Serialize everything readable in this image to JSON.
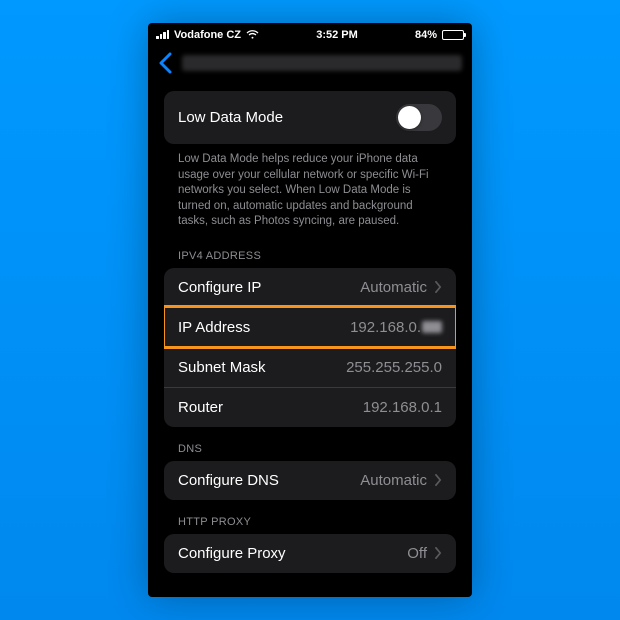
{
  "status": {
    "carrier": "Vodafone CZ",
    "time": "3:52 PM",
    "battery_pct": "84%",
    "battery_fill": 84
  },
  "nav": {
    "back": "Back"
  },
  "low_data": {
    "label": "Low Data Mode",
    "description": "Low Data Mode helps reduce your iPhone data usage over your cellular network or specific Wi-Fi networks you select. When Low Data Mode is turned on, automatic updates and background tasks, such as Photos syncing, are paused."
  },
  "sections": {
    "ipv4_header": "IPV4 ADDRESS",
    "configure_ip_label": "Configure IP",
    "configure_ip_value": "Automatic",
    "ip_address_label": "IP Address",
    "ip_address_value": "192.168.0.",
    "subnet_label": "Subnet Mask",
    "subnet_value": "255.255.255.0",
    "router_label": "Router",
    "router_value": "192.168.0.1",
    "dns_header": "DNS",
    "configure_dns_label": "Configure DNS",
    "configure_dns_value": "Automatic",
    "proxy_header": "HTTP PROXY",
    "configure_proxy_label": "Configure Proxy",
    "configure_proxy_value": "Off"
  }
}
